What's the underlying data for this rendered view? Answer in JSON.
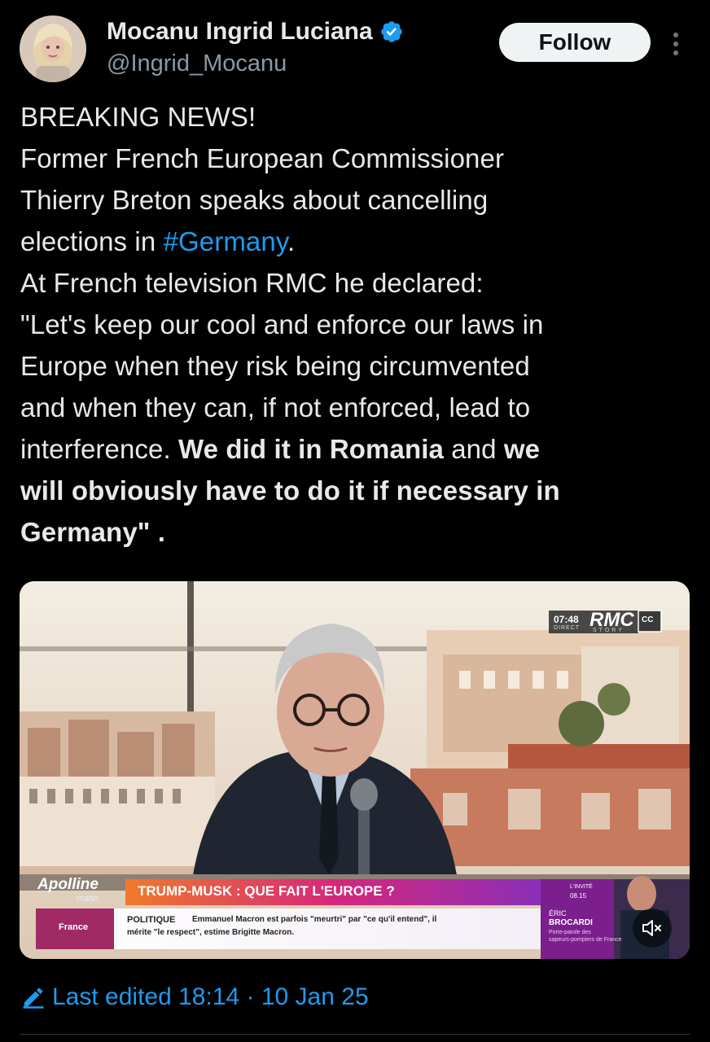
{
  "author": {
    "display_name": "Mocanu Ingrid Luciana",
    "handle": "@Ingrid_Mocanu",
    "verified": true
  },
  "actions": {
    "follow_label": "Follow"
  },
  "tweet": {
    "line1": "BREAKING NEWS!",
    "line2": "Former French European Commissioner",
    "line3": "Thierry Breton speaks about cancelling",
    "line4_prefix": "elections in ",
    "hashtag": "#Germany",
    "line4_suffix": ".",
    "line5": "At French television RMC he declared:",
    "line6": "\"Let's keep our cool and enforce our laws in",
    "line7": "Europe when they risk being circumvented",
    "line8": "and when they can, if not enforced, lead to",
    "line9_prefix": "interference. ",
    "line9_bold1": "We did it in Romania",
    "line9_mid": " and ",
    "line9_bold2": "we",
    "line10_bold": "will obviously have to do it if necessary in",
    "line11_bold": "Germany\"",
    "line11_suffix": " ."
  },
  "media": {
    "clock": "07:48",
    "direct": "DIRECT",
    "channel": "RMC",
    "channel_sub": "STORY",
    "cc_label": "CC",
    "show_name": "Apolline",
    "show_sub": "matin",
    "headline": "TRUMP-MUSK : QUE FAIT L'EUROPE ?",
    "region": "France",
    "ticker_label": "POLITIQUE",
    "ticker_line1": "Emmanuel Macron est parfois \"meurtri\" par \"ce qu'il entend\", il",
    "ticker_line2": "mérite \"le respect\", estime Brigitte Macron.",
    "guest_tag": "L'INVITÉ",
    "guest_time": "08.15",
    "guest_first": "ÉRIC",
    "guest_last": "BROCARDI",
    "guest_role1": "Porte-parole des",
    "guest_role2": "sapeurs-pompiers de France"
  },
  "footer": {
    "edited_label": "Last edited 18:14 · 10 Jan 25"
  },
  "colors": {
    "accent": "#1d9bf0",
    "text": "#e7e9ea",
    "muted": "#8b98a5",
    "background": "#000000"
  },
  "icons": [
    "avatar",
    "verified-badge-icon",
    "more-options-icon",
    "closed-captions-icon",
    "mute-icon",
    "pencil-icon"
  ]
}
